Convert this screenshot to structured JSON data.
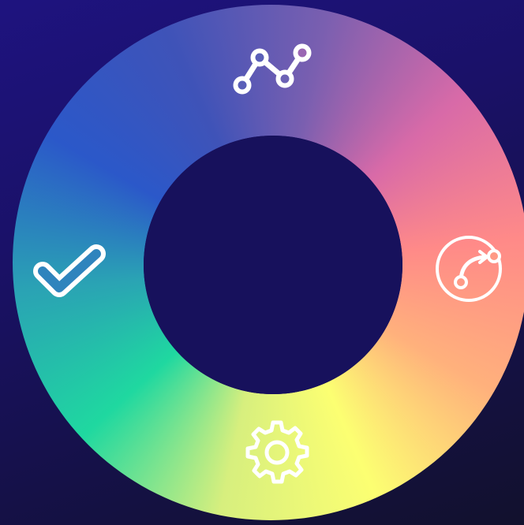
{
  "theme": {
    "background_top": "#1e137f",
    "background_bottom": "#12112d",
    "hole_color": "#17115c",
    "icon_color": "#ffffff"
  },
  "ring": {
    "gradient_colors": [
      "#2b58c9",
      "#3f53b8",
      "#7a5fb0",
      "#d86aa8",
      "#ff8a88",
      "#ffb17c",
      "#fcff72",
      "#d7ef7e",
      "#1fd8a0",
      "#2aa3b4",
      "#2b58c9"
    ]
  },
  "menu": {
    "items": [
      {
        "id": "chart",
        "icon": "line-chart-icon"
      },
      {
        "id": "flow",
        "icon": "curved-arrow-circle-icon"
      },
      {
        "id": "settings",
        "icon": "gear-icon"
      },
      {
        "id": "check",
        "icon": "checkmark-icon"
      }
    ]
  }
}
